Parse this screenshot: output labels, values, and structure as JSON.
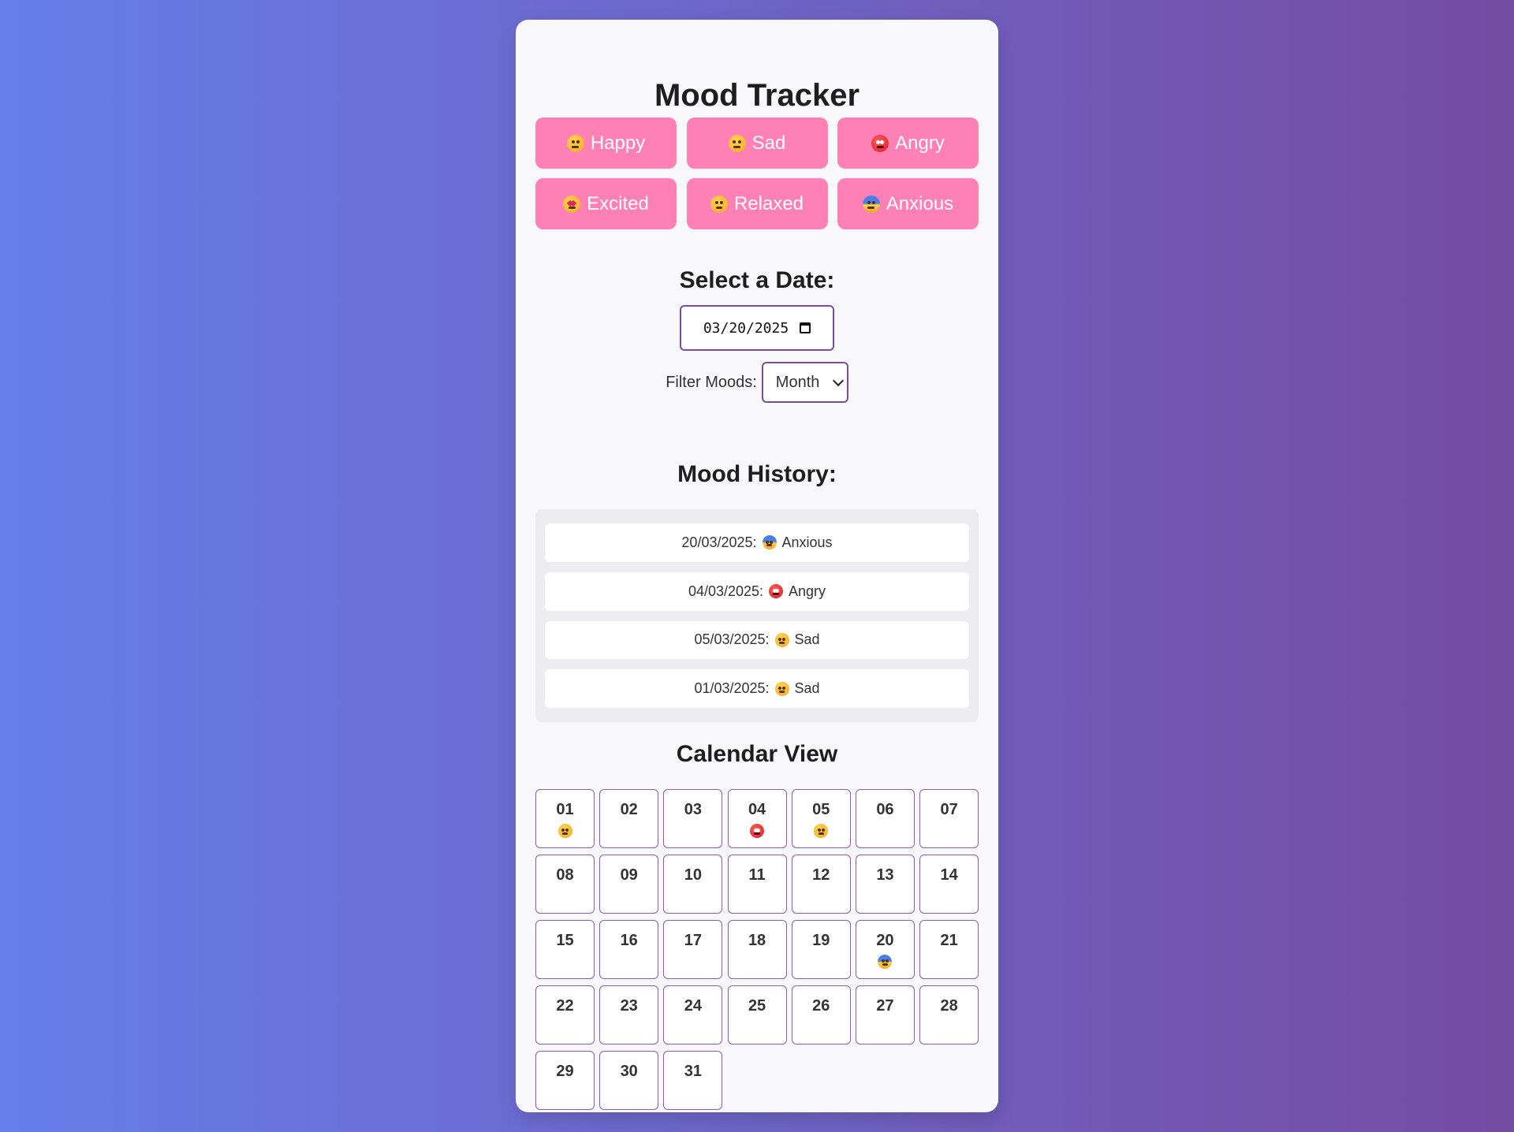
{
  "title": "Mood Tracker",
  "moods": [
    {
      "label": "Happy",
      "icon": "smiling-face-icon",
      "color": "yellow"
    },
    {
      "label": "Sad",
      "icon": "sad-face-icon",
      "color": "yellow"
    },
    {
      "label": "Angry",
      "icon": "angry-face-icon",
      "color": "red"
    },
    {
      "label": "Excited",
      "icon": "star-struck-icon",
      "color": "star"
    },
    {
      "label": "Relaxed",
      "icon": "relieved-face-icon",
      "color": "yellow"
    },
    {
      "label": "Anxious",
      "icon": "fearful-face-icon",
      "color": "blue"
    }
  ],
  "date_section": {
    "heading": "Select a Date:",
    "date_value": "03/20/2025"
  },
  "filter": {
    "label": "Filter Moods:",
    "selected": "Month"
  },
  "history": {
    "heading": "Mood History:",
    "items": [
      {
        "date": "20/03/2025:",
        "mood": "Anxious",
        "icon": "fearful-face-icon",
        "color": "blue"
      },
      {
        "date": "04/03/2025:",
        "mood": "Angry",
        "icon": "angry-face-icon",
        "color": "red"
      },
      {
        "date": "05/03/2025:",
        "mood": "Sad",
        "icon": "sad-face-icon",
        "color": "yellow"
      },
      {
        "date": "01/03/2025:",
        "mood": "Sad",
        "icon": "sad-face-icon",
        "color": "yellow"
      }
    ]
  },
  "calendar": {
    "heading": "Calendar View",
    "days": [
      {
        "num": "01",
        "mood": "sad"
      },
      {
        "num": "02"
      },
      {
        "num": "03"
      },
      {
        "num": "04",
        "mood": "angry"
      },
      {
        "num": "05",
        "mood": "sad"
      },
      {
        "num": "06"
      },
      {
        "num": "07"
      },
      {
        "num": "08"
      },
      {
        "num": "09"
      },
      {
        "num": "10"
      },
      {
        "num": "11"
      },
      {
        "num": "12"
      },
      {
        "num": "13"
      },
      {
        "num": "14"
      },
      {
        "num": "15"
      },
      {
        "num": "16"
      },
      {
        "num": "17"
      },
      {
        "num": "18"
      },
      {
        "num": "19"
      },
      {
        "num": "20",
        "mood": "anxious"
      },
      {
        "num": "21"
      },
      {
        "num": "22"
      },
      {
        "num": "23"
      },
      {
        "num": "24"
      },
      {
        "num": "25"
      },
      {
        "num": "26"
      },
      {
        "num": "27"
      },
      {
        "num": "28"
      },
      {
        "num": "29"
      },
      {
        "num": "30"
      },
      {
        "num": "31"
      }
    ]
  },
  "colors": {
    "mood_button_bg": "#ff80b5",
    "accent_border": "#764ba2",
    "bg_gradient_start": "#667eea",
    "bg_gradient_end": "#764ba2"
  }
}
